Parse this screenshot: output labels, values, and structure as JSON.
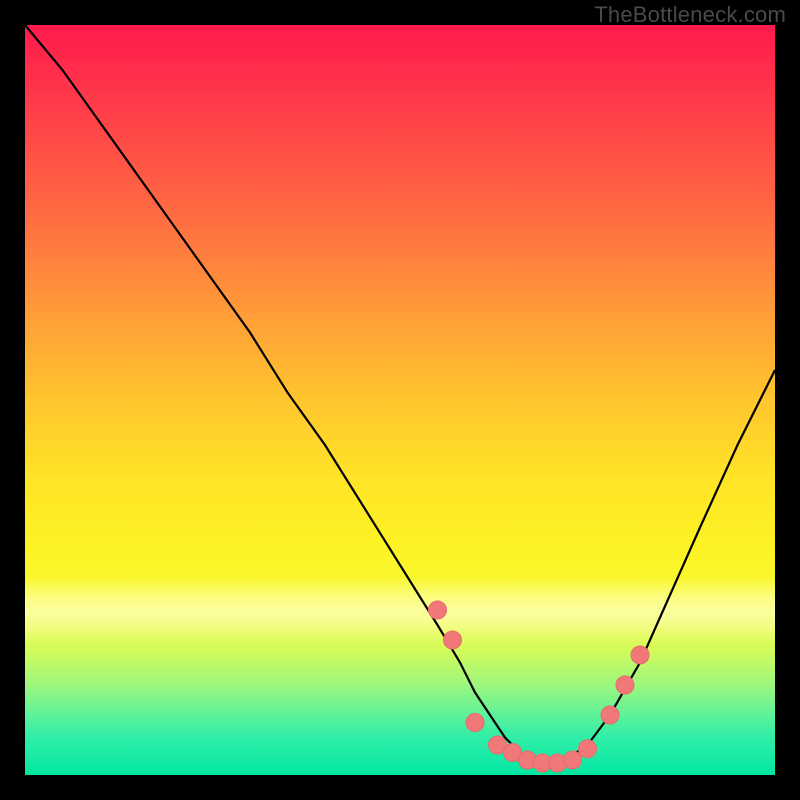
{
  "watermark": "TheBottleneck.com",
  "colors": {
    "frame": "#000000",
    "curve": "#000000",
    "marker_fill": "#f07878",
    "marker_stroke": "#e86b6b"
  },
  "chart_data": {
    "type": "line",
    "title": "",
    "xlabel": "",
    "ylabel": "",
    "xlim": [
      0,
      100
    ],
    "ylim": [
      0,
      100
    ],
    "grid": false,
    "legend": false,
    "series": [
      {
        "name": "bottleneck-curve",
        "x": [
          0,
          5,
          10,
          15,
          20,
          25,
          30,
          35,
          40,
          45,
          50,
          55,
          58,
          60,
          62,
          64,
          66,
          68,
          70,
          72,
          75,
          78,
          82,
          86,
          90,
          95,
          100
        ],
        "y": [
          100,
          94,
          87,
          80,
          73,
          66,
          59,
          51,
          44,
          36,
          28,
          20,
          15,
          11,
          8,
          5,
          3,
          2,
          1.5,
          2,
          4,
          8,
          15,
          24,
          33,
          44,
          54
        ]
      }
    ],
    "markers": {
      "name": "highlight-points",
      "x": [
        55,
        57,
        60,
        63,
        65,
        67,
        69,
        71,
        73,
        75,
        78,
        80,
        82
      ],
      "y": [
        22,
        18,
        7,
        4,
        3,
        2,
        1.6,
        1.6,
        2,
        3.5,
        8,
        12,
        16
      ]
    }
  }
}
